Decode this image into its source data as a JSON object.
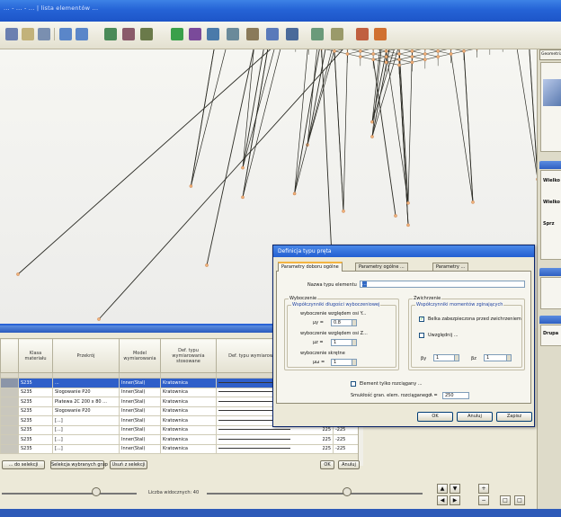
{
  "window": {
    "title": "... - ... - ... | lista elementów ..."
  },
  "dialog": {
    "title": "Definicja typu pręta",
    "tabs": [
      "Parametry doboru ogólne",
      "Parametry ogólne ...",
      "Parametry ..."
    ],
    "element_name_label": "Nazwa typu elementu",
    "element_name_value": "...",
    "buckling": {
      "group_title": "Wyboczenie",
      "subgroup_title": "Współczynniki długości wyboczeniowej",
      "y_label": "wyboczenie względem osi Y...",
      "y_symbol": "μy =",
      "y_value": "0.8",
      "z_label": "wyboczenie względem osi Z...",
      "z_symbol": "μz =",
      "z_value": "1",
      "torsion_label": "wyboczenie skrętne",
      "torsion_symbol": "μω =",
      "torsion_value": "1"
    },
    "lateral": {
      "group_title": "Zwichrzenie",
      "subgroup_title": "Współczynniki momentów zginających",
      "check1_label": "Belka zabezpieczona przed zwichrzeniem",
      "check2_label": "Uwzględnij ...",
      "b_y_symbol": "βy",
      "b_y_value": "1",
      "b_z_symbol": "βz",
      "b_z_value": "1"
    },
    "tension_only_label": "Element tylko rozciągany ...",
    "slenderness_label": "Smukłość gran. elem. rozciąganego",
    "slenderness_symbol": "λ =",
    "slenderness_value": "250",
    "buttons": {
      "ok": "OK",
      "cancel": "Anuluj",
      "save": "Zapisz"
    }
  },
  "table": {
    "headers": [
      "",
      "Klasa materiału",
      "Przekrój",
      "Model wymiarowania",
      "Def. typu wymiarowania stosowane",
      "Def. typu wymiarowania w odniesieniu ...",
      ""
    ],
    "rows": [
      {
        "c0": "",
        "material": "S235",
        "section": "...",
        "model": "Inner(Stal)",
        "type": "Kratownica",
        "n1": "",
        "n2": "",
        "selected": true
      },
      {
        "c0": "",
        "material": "S235",
        "section": "Slogowanie P20",
        "model": "Inner(Stal)",
        "type": "Kratownica",
        "n1": "",
        "n2": "",
        "selected": false
      },
      {
        "c0": "",
        "material": "S235",
        "section": "Platewa 2C 200 x 80 ...",
        "model": "Inner(Stal)",
        "type": "Kratownica",
        "n1": "",
        "n2": "",
        "selected": false
      },
      {
        "c0": "",
        "material": "S235",
        "section": "Slogowanie P20",
        "model": "Inner(Stal)",
        "type": "Kratownica",
        "n1": "",
        "n2": "",
        "selected": false
      },
      {
        "c0": "",
        "material": "S235",
        "section": "[...]",
        "model": "Inner(Stal)",
        "type": "Kratownica",
        "n1": "",
        "n2": "",
        "selected": false
      },
      {
        "c0": "",
        "material": "S235",
        "section": "[...]",
        "model": "Inner(Stal)",
        "type": "Kratownica",
        "n1": "225",
        "n2": "-225",
        "selected": false
      },
      {
        "c0": "",
        "material": "S235",
        "section": "[...]",
        "model": "Inner(Stal)",
        "type": "Kratownica",
        "n1": "225",
        "n2": "-225",
        "selected": false
      },
      {
        "c0": "",
        "material": "S235",
        "section": "[...]",
        "model": "Inner(Stal)",
        "type": "Kratownica",
        "n1": "225",
        "n2": "-225",
        "selected": false
      }
    ],
    "buttons": [
      "... do selekcji",
      "Selekcja wybranych grup",
      "Usuń z selekcji",
      "OK",
      "Anuluj"
    ]
  },
  "slider": {
    "label": "Liczba widocznych: 40"
  },
  "right_dock": {
    "tab": "Geometria",
    "label1": "Wielko",
    "label2": "Wielko",
    "label3": "Sprz",
    "label4": "Drupa"
  }
}
